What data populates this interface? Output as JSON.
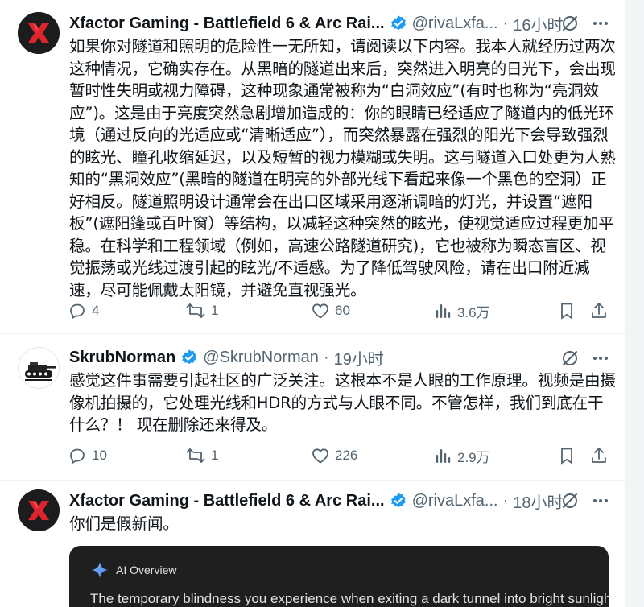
{
  "tweets": [
    {
      "author": "Xfactor Gaming - Battlefield 6 & Arc Rai...",
      "handle": "@rivaLxfa...",
      "time": "16小时",
      "text": "如果你对隧道和照明的危险性一无所知，请阅读以下内容。我本人就经历过两次这种情况，它确实存在。从黑暗的隧道出来后，突然进入明亮的日光下，会出现暂时性失明或视力障碍，这种现象通常被称为“白洞效应”(有时也称为“亮洞效应”)。这是由于亮度突然急剧增加造成的：你的眼睛已经适应了隧道内的低光环境（通过反向的光适应或“清晰适应”），而突然暴露在强烈的阳光下会导致强烈的眩光、瞳孔收缩延迟，以及短暂的视力模糊或失明。这与隧道入口处更为人熟知的“黑洞效应”(黑暗的隧道在明亮的外部光线下看起来像一个黑色的空洞）正好相反。隧道照明设计通常会在出口区域采用逐渐调暗的灯光，并设置“遮阳板”(遮阳篷或百叶窗）等结构，以减轻这种突然的眩光，使视觉适应过程更加平稳。在科学和工程领域（例如，高速公路隧道研究)，它也被称为瞬态盲区、视觉振荡或光线过渡引起的眩光/不适感。为了降低驾驶风险，请在出口附近减速，尽可能佩戴太阳镜，并避免直视强光。",
      "replies": "4",
      "reposts": "1",
      "likes": "60",
      "views": "3.6万"
    },
    {
      "author": "SkrubNorman",
      "handle": "@SkrubNorman",
      "time": "19小时",
      "text": "感觉这件事需要引起社区的广泛关注。这根本不是人眼的工作原理。视频是由摄像机拍摄的，它处理光线和HDR的方式与人眼不同。不管怎样，我们到底在干什么？！ 现在删除还来得及。",
      "replies": "10",
      "reposts": "1",
      "likes": "226",
      "views": "2.9万"
    },
    {
      "author": "Xfactor Gaming - Battlefield 6 & Arc Rai...",
      "handle": "@rivaLxfa...",
      "time": "18小时",
      "text": "你们是假新闻。"
    }
  ],
  "ai_card": {
    "title": "AI Overview",
    "text": "The temporary blindness you experience when exiting a dark tunnel into bright sunlight is"
  },
  "colors": {
    "muted": "#536471",
    "verified": "#1d9bf0",
    "xfactor_red": "#e0242b"
  }
}
